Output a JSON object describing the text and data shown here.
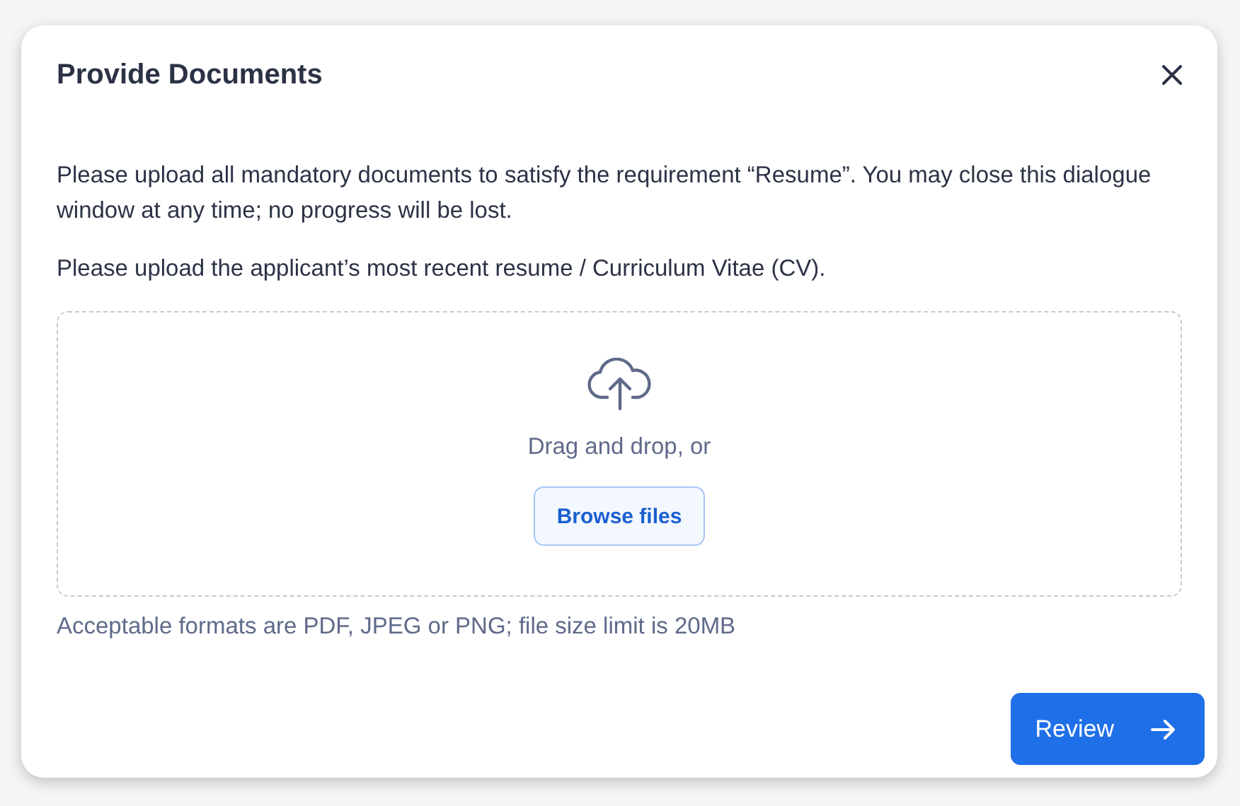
{
  "dialog": {
    "title": "Provide Documents",
    "intro": "Please upload all mandatory documents to satisfy the requirement “Resume”. You may close this dialogue window at any time; no progress will be lost.",
    "instruction": "Please upload the applicant’s most recent resume / Curriculum Vitae (CV).",
    "dropzone": {
      "prompt": "Drag and drop, or",
      "browse_button": "Browse files"
    },
    "hint": "Acceptable formats are PDF, JPEG or PNG; file size limit is 20MB",
    "buttons": [
      {
        "label": "Review",
        "kind": "primary"
      }
    ]
  }
}
